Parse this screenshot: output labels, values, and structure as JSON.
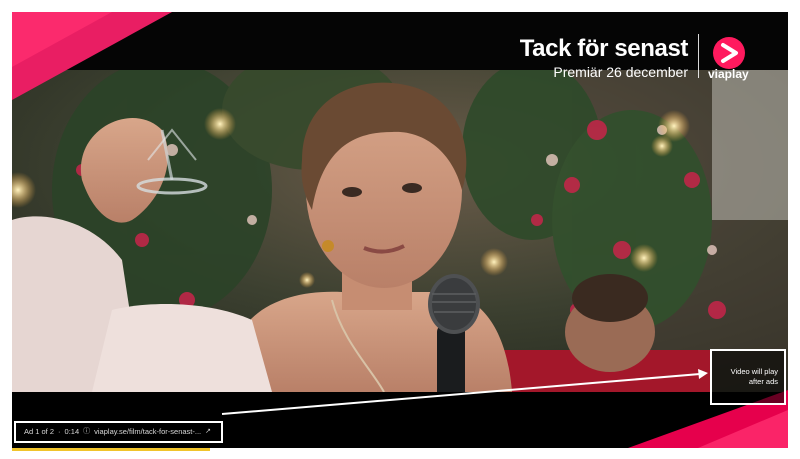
{
  "video": {
    "show_title": "Tack för senast",
    "premiere": "Premiär 26 december",
    "logo_text": "viaplay"
  },
  "ad": {
    "counter": "Ad 1 of 2",
    "time": "0:14",
    "link": "viaplay.se/film/tack-for-senast-...",
    "skip_notice_line1": "Video will play",
    "skip_notice_line2": "after ads"
  },
  "colors": {
    "brand_pink": "#ff1a5e",
    "brand_red": "#e6004c",
    "annotation": "#ffffff",
    "progress": "#f0c42c"
  },
  "icons": {
    "info": "info-icon",
    "external_link": "external-link-icon",
    "logo": "viaplay-play-logo"
  }
}
